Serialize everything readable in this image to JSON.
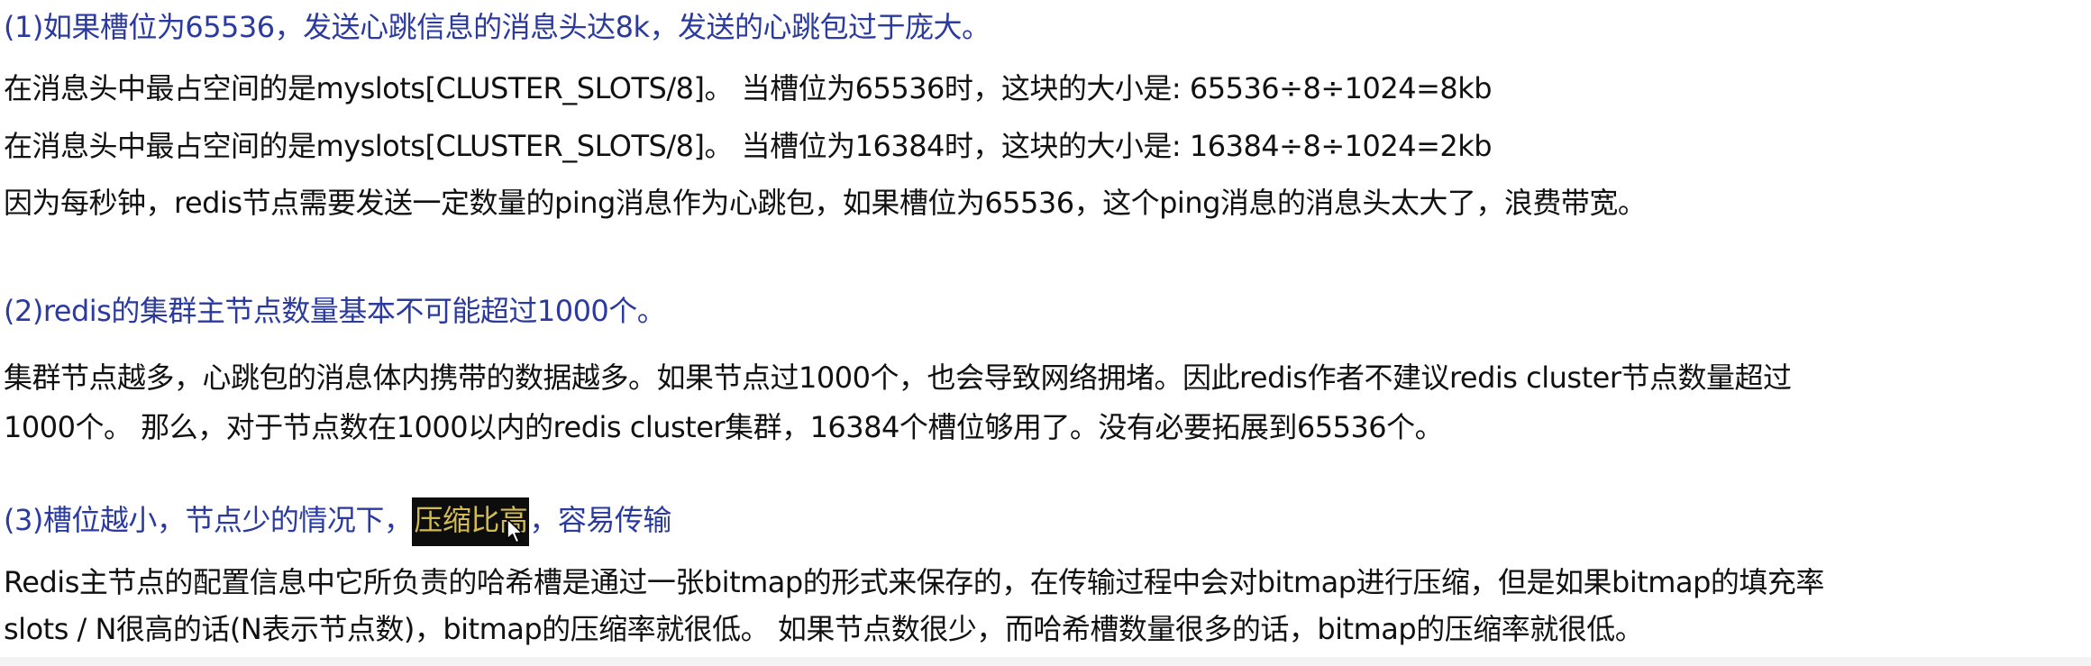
{
  "sections": [
    {
      "heading": "(1)如果槽位为65536，发送心跳信息的消息头达8k，发送的心跳包过于庞大。",
      "lines": [
        "在消息头中最占空间的是myslots[CLUSTER_SLOTS/8]。 当槽位为65536时，这块的大小是: 65536÷8÷1024=8kb",
        "在消息头中最占空间的是myslots[CLUSTER_SLOTS/8]。 当槽位为16384时，这块的大小是: 16384÷8÷1024=2kb",
        "因为每秒钟，redis节点需要发送一定数量的ping消息作为心跳包，如果槽位为65536，这个ping消息的消息头太大了，浪费带宽。"
      ]
    },
    {
      "heading": "(2)redis的集群主节点数量基本不可能超过1000个。",
      "lines": [
        "集群节点越多，心跳包的消息体内携带的数据越多。如果节点过1000个，也会导致网络拥堵。因此redis作者不建议redis cluster节点数量超过",
        "1000个。 那么，对于节点数在1000以内的redis cluster集群，16384个槽位够用了。没有必要拓展到65536个。"
      ]
    },
    {
      "heading_before": "(3)槽位越小，节点少的情况下，",
      "heading_highlight": "压缩比高",
      "heading_after": "，容易传输",
      "lines": [
        "Redis主节点的配置信息中它所负责的哈希槽是通过一张bitmap的形式来保存的，在传输过程中会对bitmap进行压缩，但是如果bitmap的填充率",
        "slots / N很高的话(N表示节点数)，bitmap的压缩率就很低。 如果节点数很少，而哈希槽数量很多的话，bitmap的压缩率就很低。"
      ]
    }
  ],
  "colors": {
    "heading": "#2a3a9e",
    "body": "#111111",
    "highlight_bg": "#0d0d0d",
    "highlight_text": "#d2bc52"
  },
  "icons": {
    "cursor": "mouse-pointer-icon"
  }
}
